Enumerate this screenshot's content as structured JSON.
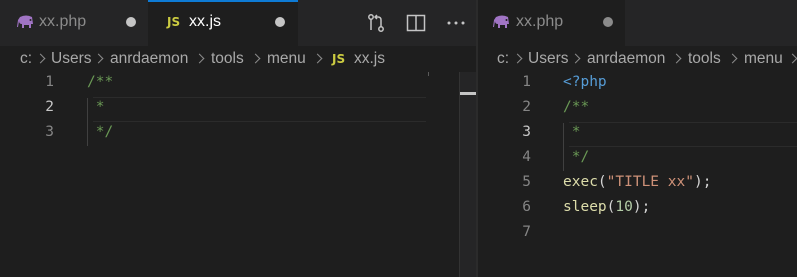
{
  "left_group": {
    "tabs": [
      {
        "label": "xx.php",
        "icon": "php-elephant-icon",
        "active": false,
        "dirty": true
      },
      {
        "label": "xx.js",
        "icon_text": "JS",
        "active": true,
        "dirty": true
      }
    ],
    "actions": [
      {
        "name": "open-changes-icon",
        "glyph": "⇄"
      },
      {
        "name": "split-editor-icon",
        "glyph": "◫"
      },
      {
        "name": "more-actions-icon",
        "glyph": "···"
      }
    ],
    "breadcrumb": {
      "items": [
        "c:",
        "Users",
        "anrdaemon",
        "tools",
        "menu"
      ],
      "file_icon_text": "JS",
      "file": "xx.js"
    },
    "lines": [
      {
        "num": "1",
        "text": "/**"
      },
      {
        "num": "2",
        "text": " *"
      },
      {
        "num": "3",
        "text": " */"
      }
    ],
    "current_line": "2"
  },
  "right_group": {
    "tabs": [
      {
        "label": "xx.php",
        "icon": "php-elephant-icon",
        "active": true,
        "dirty": true
      }
    ],
    "breadcrumb": {
      "items": [
        "c:",
        "Users",
        "anrdaemon",
        "tools",
        "menu"
      ]
    },
    "lines": [
      {
        "num": "1",
        "text": "<?php"
      },
      {
        "num": "2",
        "text": "/**"
      },
      {
        "num": "3",
        "text": " *"
      },
      {
        "num": "4",
        "text": " */"
      },
      {
        "num": "5",
        "fn": "exec",
        "open": "(",
        "str": "\"TITLE xx\"",
        "close": ");"
      },
      {
        "num": "6",
        "fn": "sleep",
        "open": "(",
        "num_val": "10",
        "close": ");"
      },
      {
        "num": "7",
        "text": ""
      }
    ],
    "current_line": "3"
  },
  "colors": {
    "accent": "#0e7bd5",
    "php_icon": "#a074c4",
    "js_icon": "#cbcb41",
    "comment": "#6a9955",
    "string": "#ce9178",
    "function": "#dcdcaa",
    "number": "#b5cea8",
    "keyword_tag": "#569cd6"
  }
}
